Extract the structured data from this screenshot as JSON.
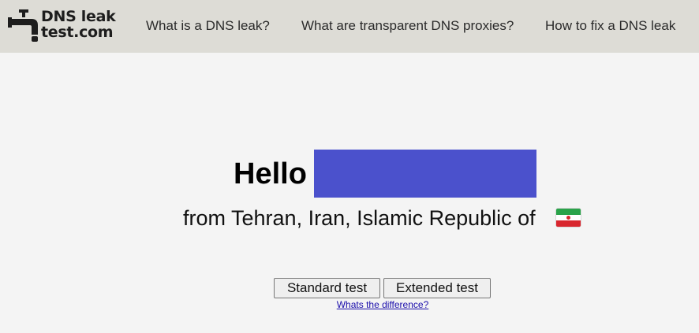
{
  "header": {
    "logo": {
      "line1": "DNS leak",
      "line2": "test.com",
      "icon": "faucet-icon"
    },
    "nav": [
      {
        "label": "What is a DNS leak?"
      },
      {
        "label": "What are transparent DNS proxies?"
      },
      {
        "label": "How to fix a DNS leak"
      }
    ],
    "background_color": "#dddcd6"
  },
  "main": {
    "greeting": "Hello",
    "ip_redaction_color": "#4b51cc",
    "location": "from Tehran, Iran, Islamic Republic of",
    "flag_icon": "iran-flag-icon",
    "buttons": {
      "standard": "Standard test",
      "extended": "Extended test"
    },
    "difference_link": "Whats the difference?"
  }
}
